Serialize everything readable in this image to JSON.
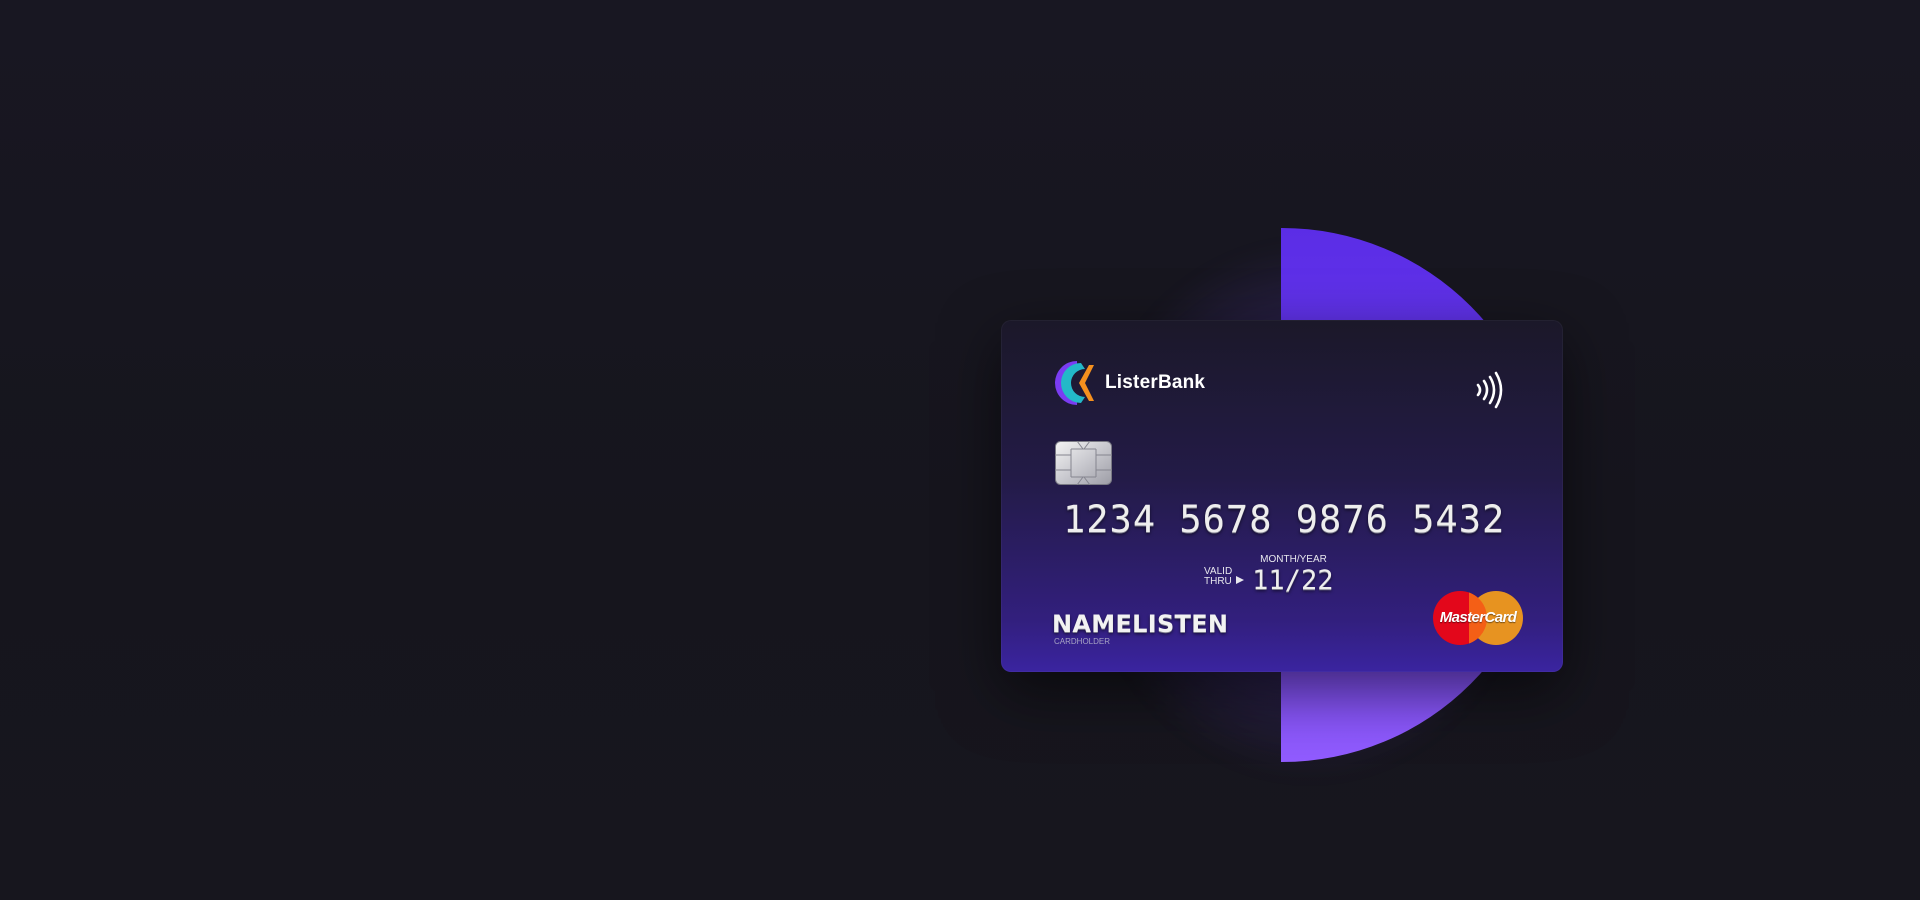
{
  "card": {
    "bank_name": "ListerBank",
    "number": "1234 5678 9876 5432",
    "valid_thru_line1": "VALID",
    "valid_thru_line2": "THRU",
    "month_year_label": "MONTH/YEAR",
    "expiry": "11/22",
    "holder_name": "NAMELISTEN",
    "holder_label": "CARDHOLDER",
    "network": "MasterCard"
  },
  "icons": {
    "bank_logo": "listerbank-logo-icon",
    "contactless": "contactless-icon",
    "chip": "chip-icon",
    "network_logo": "mastercard-logo-icon"
  },
  "colors": {
    "background": "#17161f",
    "accent_purple": "#6a3cf0",
    "card_top": "#1b1829",
    "card_bottom": "#3a24a0",
    "mc_red": "#e3071b",
    "mc_orange": "#f19a1b"
  }
}
